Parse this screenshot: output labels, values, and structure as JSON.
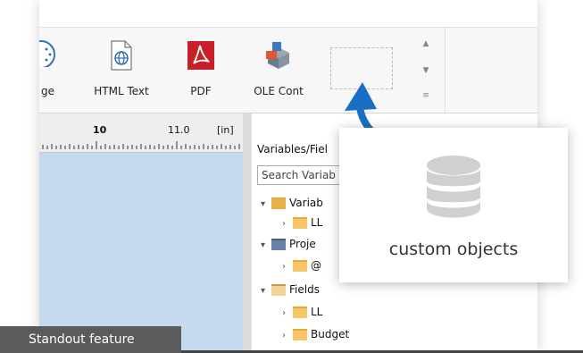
{
  "ribbon": {
    "buttons": [
      {
        "label": "ge",
        "icon": "image-circle-icon"
      },
      {
        "label": "HTML Text",
        "icon": "html-globe-icon"
      },
      {
        "label": "PDF",
        "icon": "pdf-icon"
      },
      {
        "label": "OLE Cont",
        "icon": "ole-container-icon"
      }
    ]
  },
  "ruler": {
    "mark_a": "10",
    "mark_b": "11.0",
    "unit": "[in]"
  },
  "panel": {
    "title": "Variables/Fiel",
    "search_placeholder": "Search Variab",
    "tree": [
      {
        "label": "Variab",
        "icon": "variables-icon",
        "level": 0,
        "expanded": true
      },
      {
        "label": "LL",
        "icon": "folder-icon",
        "level": 1,
        "expanded": false
      },
      {
        "label": "Proje",
        "icon": "project-icon",
        "level": 0,
        "expanded": true
      },
      {
        "label": "@",
        "icon": "folder-icon",
        "level": 1,
        "expanded": false
      },
      {
        "label": "Fields",
        "icon": "fields-icon",
        "level": 0,
        "expanded": true
      },
      {
        "label": "LL",
        "icon": "folder-icon",
        "level": 1,
        "expanded": false
      },
      {
        "label": "Budget",
        "icon": "folder-icon",
        "level": 1,
        "expanded": false
      }
    ]
  },
  "callout": {
    "label": "custom objects",
    "icon": "database-icon"
  },
  "badge": {
    "label": "Standout feature"
  },
  "colors": {
    "accent": "#1a6fc4",
    "workarea": "#c5daee",
    "badge": "#5b5b5b"
  }
}
